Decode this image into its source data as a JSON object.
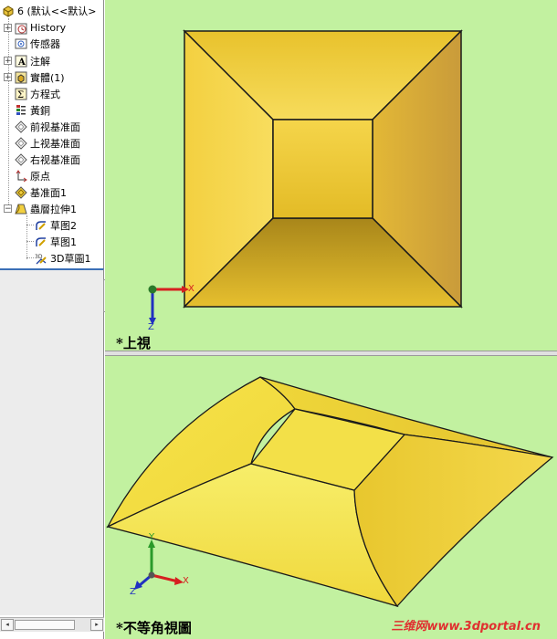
{
  "tree": {
    "root": "6 (默认<<默认>",
    "items": [
      {
        "label": "History",
        "icon": "history-icon",
        "expandable": true
      },
      {
        "label": "传感器",
        "icon": "sensor-icon",
        "expandable": false
      },
      {
        "label": "注解",
        "icon": "annotation-icon",
        "expandable": true
      },
      {
        "label": "實體(1)",
        "icon": "solid-bodies-icon",
        "expandable": true
      },
      {
        "label": "方程式",
        "icon": "equation-icon",
        "expandable": false
      },
      {
        "label": "黃銅",
        "icon": "material-icon",
        "expandable": false
      },
      {
        "label": "前视基准面",
        "icon": "plane-icon",
        "expandable": false
      },
      {
        "label": "上视基准面",
        "icon": "plane-icon",
        "expandable": false
      },
      {
        "label": "右视基准面",
        "icon": "plane-icon",
        "expandable": false
      },
      {
        "label": "原点",
        "icon": "origin-icon",
        "expandable": false
      },
      {
        "label": "基准面1",
        "icon": "plane-yellow-icon",
        "expandable": false
      },
      {
        "label": "蟲層拉伸1",
        "icon": "loft-icon",
        "expandable": true
      }
    ],
    "children": [
      {
        "label": "草图2",
        "icon": "sketch-icon"
      },
      {
        "label": "草图1",
        "icon": "sketch-icon"
      },
      {
        "label": "3D草圖1",
        "icon": "sketch3d-icon"
      }
    ]
  },
  "views": {
    "top": {
      "label": "*上視",
      "axes": {
        "x": "X",
        "z": "Z"
      }
    },
    "iso": {
      "label": "*不等角視圖",
      "axes": {
        "x": "X",
        "y": "Y",
        "z": "Z"
      }
    }
  },
  "watermark": "三维网www.3dportal.cn",
  "colors": {
    "viewport_bg": "#c2f1a0",
    "part_yellow": "#f2cf3a",
    "part_edge": "#1a1a1a",
    "axis_x": "#d62020",
    "axis_y": "#2a9a2a",
    "axis_z": "#2030c0"
  }
}
